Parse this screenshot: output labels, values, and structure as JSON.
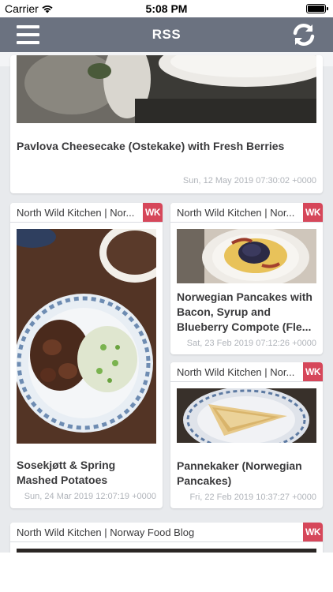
{
  "status_bar": {
    "carrier": "Carrier",
    "time": "5:08 PM"
  },
  "nav": {
    "title": "RSS"
  },
  "cards": [
    {
      "source": "",
      "badge": "",
      "title": "Pavlova Cheesecake (Ostekake) with Fresh Berries",
      "date": "Sun, 12 May 2019 07:30:02 +0000"
    },
    {
      "source": "North Wild Kitchen | Nor...",
      "badge": "WK",
      "title": "Sosekjøtt & Spring Mashed Potatoes",
      "date": "Sun, 24 Mar 2019 12:07:19 +0000"
    },
    {
      "source": "North Wild Kitchen | Nor...",
      "badge": "WK",
      "title": "Norwegian Pancakes with Bacon, Syrup and Blueberry Compote (Fle...",
      "date": "Sat, 23 Feb 2019 07:12:26 +0000"
    },
    {
      "source": "North Wild Kitchen | Nor...",
      "badge": "WK",
      "title": "Pannekaker (Norwegian Pancakes)",
      "date": "Fri, 22 Feb 2019 10:37:27 +0000"
    },
    {
      "source": "North Wild Kitchen | Norway Food Blog",
      "badge": "WK",
      "title": "",
      "date": ""
    }
  ],
  "colors": {
    "nav_bar": "#6b7280",
    "badge": "#d6475a",
    "background": "#e8eaed"
  },
  "icons": {
    "menu": "hamburger-menu-icon",
    "refresh": "refresh-icon",
    "wifi": "wifi-icon",
    "battery": "battery-icon"
  }
}
